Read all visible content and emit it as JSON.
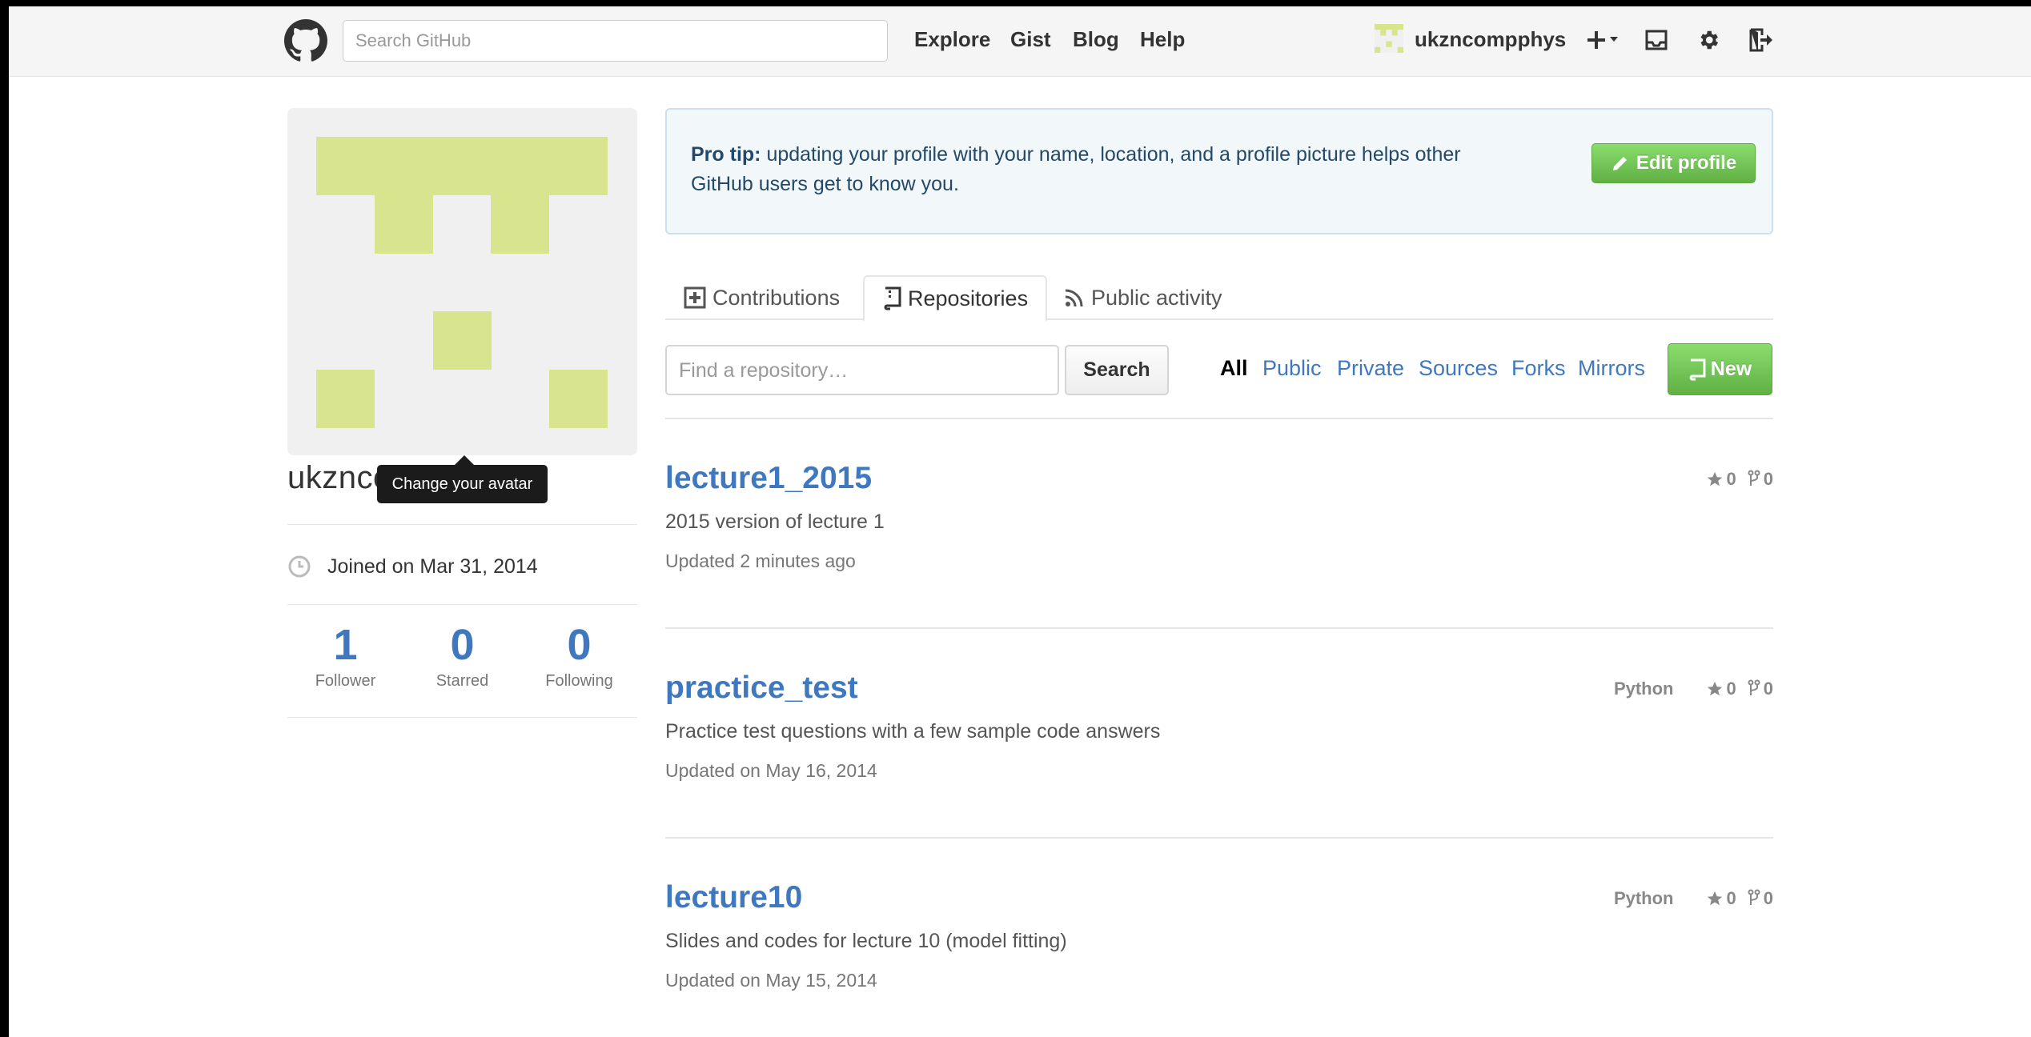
{
  "header": {
    "search_placeholder": "Search GitHub",
    "nav": [
      "Explore",
      "Gist",
      "Blog",
      "Help"
    ],
    "username": "ukzncompphys",
    "icons": [
      "github-logo-icon",
      "plus-icon",
      "inbox-icon",
      "gear-icon",
      "sign-out-icon"
    ]
  },
  "sidebar": {
    "profile_name": "ukzncompphys",
    "tooltip": "Change your avatar",
    "joined": "Joined on Mar 31, 2014",
    "stats": [
      {
        "value": "1",
        "label": "Follower"
      },
      {
        "value": "0",
        "label": "Starred"
      },
      {
        "value": "0",
        "label": "Following"
      }
    ]
  },
  "protip": {
    "label": "Pro tip:",
    "text": " updating your profile with your name, location, and a profile picture helps other GitHub users get to know you.",
    "button": "Edit profile"
  },
  "tabs": [
    "Contributions",
    "Repositories",
    "Public activity"
  ],
  "filter_bar": {
    "find_placeholder": "Find a repository…",
    "search_button": "Search",
    "filters": [
      "All",
      "Public",
      "Private",
      "Sources",
      "Forks",
      "Mirrors"
    ],
    "new_button": "New"
  },
  "repos": [
    {
      "name": "lecture1_2015",
      "description": "2015 version of lecture 1",
      "updated": "Updated 2 minutes ago",
      "language": "",
      "stars": "0",
      "forks": "0"
    },
    {
      "name": "practice_test",
      "description": "Practice test questions with a few sample code answers",
      "updated": "Updated on May 16, 2014",
      "language": "Python",
      "stars": "0",
      "forks": "0"
    },
    {
      "name": "lecture10",
      "description": "Slides and codes for lecture 10 (model fitting)",
      "updated": "Updated on May 15, 2014",
      "language": "Python",
      "stars": "0",
      "forks": "0"
    }
  ],
  "colors": {
    "link": "#4078c0",
    "green_button": "#6cc644",
    "identicon": "#d9e48f",
    "protip_bg": "#f2f8fa"
  }
}
